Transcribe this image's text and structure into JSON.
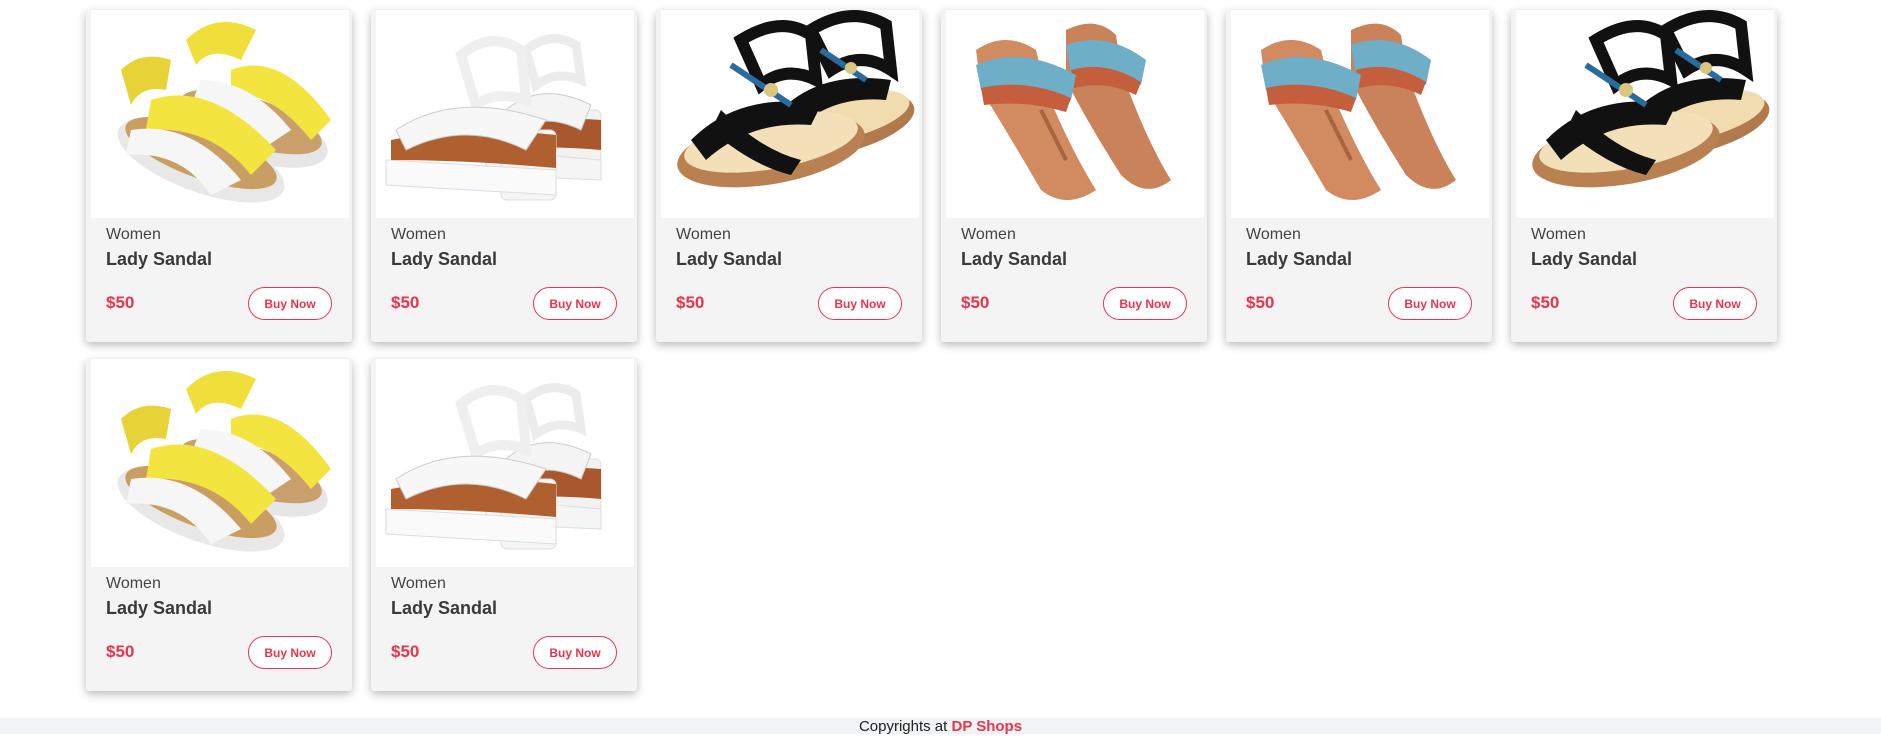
{
  "products": [
    {
      "category": "Women",
      "name": "Lady Sandal",
      "price": "$50",
      "buy_label": "Buy Now",
      "image": "yellow-cross-strap-sandal"
    },
    {
      "category": "Women",
      "name": "Lady Sandal",
      "price": "$50",
      "buy_label": "Buy Now",
      "image": "white-platform-sandal"
    },
    {
      "category": "Women",
      "name": "Lady Sandal",
      "price": "$50",
      "buy_label": "Buy Now",
      "image": "black-beaded-wedge-sandal"
    },
    {
      "category": "Women",
      "name": "Lady Sandal",
      "price": "$50",
      "buy_label": "Buy Now",
      "image": "tan-beaded-thong-sandal"
    },
    {
      "category": "Women",
      "name": "Lady Sandal",
      "price": "$50",
      "buy_label": "Buy Now",
      "image": "tan-beaded-thong-sandal"
    },
    {
      "category": "Women",
      "name": "Lady Sandal",
      "price": "$50",
      "buy_label": "Buy Now",
      "image": "black-beaded-wedge-sandal"
    },
    {
      "category": "Women",
      "name": "Lady Sandal",
      "price": "$50",
      "buy_label": "Buy Now",
      "image": "yellow-cross-strap-sandal"
    },
    {
      "category": "Women",
      "name": "Lady Sandal",
      "price": "$50",
      "buy_label": "Buy Now",
      "image": "white-platform-sandal"
    }
  ],
  "footer": {
    "prefix": "Copyrights at",
    "brand": "DP Shops"
  },
  "colors": {
    "accent": "#e8344e",
    "card_bg": "#f4f4f4",
    "footer_bg": "#f1f3f4"
  }
}
